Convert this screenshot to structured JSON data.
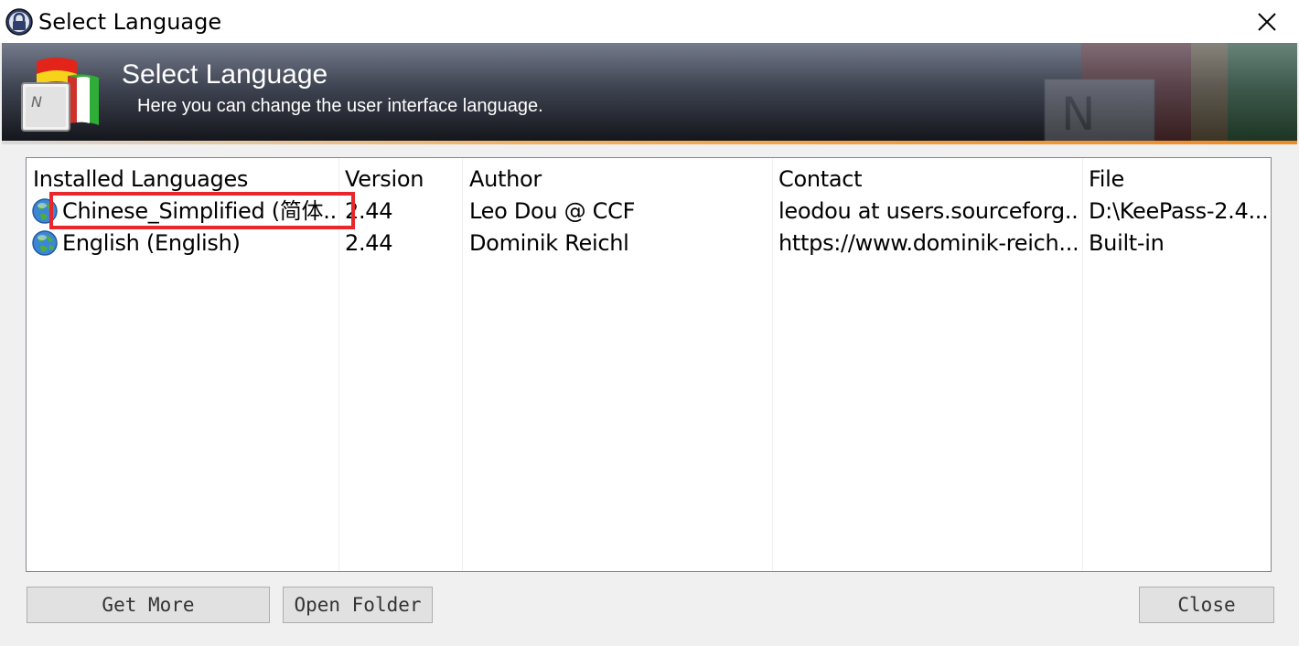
{
  "window": {
    "title": "Select Language"
  },
  "banner": {
    "title": "Select Language",
    "description": "Here you can change the user interface language."
  },
  "list": {
    "columns": [
      "Installed Languages",
      "Version",
      "Author",
      "Contact",
      "File"
    ],
    "rows": [
      {
        "language": "Chinese_Simplified (简体...",
        "version": "2.44",
        "author": "Leo Dou @ CCF",
        "contact": "leodou at users.sourceforg...",
        "file": "D:\\KeePass-2.4..."
      },
      {
        "language": "English (English)",
        "version": "2.44",
        "author": "Dominik Reichl",
        "contact": "https://www.dominik-reich...",
        "file": "Built-in"
      }
    ]
  },
  "buttons": {
    "get_more": "Get More",
    "open_folder": "Open Folder",
    "close": "Close"
  },
  "colors": {
    "highlight": "#e8262c",
    "banner_top": "#747b8b",
    "banner_bottom": "#14161c",
    "accent_stripe": "#f08a24"
  }
}
